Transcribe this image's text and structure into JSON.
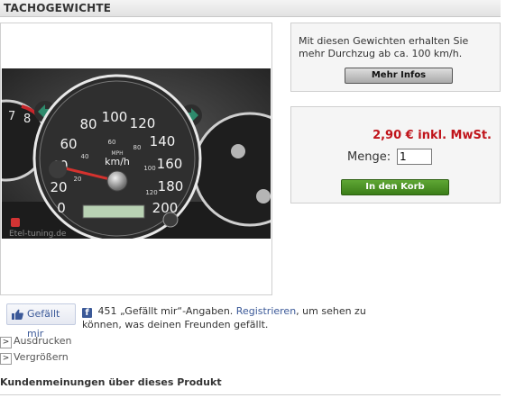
{
  "header": {
    "title": "TACHOGEWICHTE"
  },
  "product_image": {
    "alt": "Tachometer",
    "watermark": "Etel-tuning.de",
    "dial_numbers": [
      "0",
      "20",
      "40",
      "60",
      "80",
      "100",
      "120",
      "140",
      "160",
      "180",
      "200"
    ],
    "inner_numbers": [
      "20",
      "40",
      "60",
      "80",
      "100",
      "120"
    ],
    "unit": "km/h",
    "unit_small": "MPH",
    "left_numbers": [
      "7",
      "8"
    ]
  },
  "info_box": {
    "text": "Mit diesen Gewichten erhalten Sie mehr Durchzug ab ca. 100 km/h.",
    "more_button": "Mehr Infos"
  },
  "purchase": {
    "price": "2,90 € inkl. MwSt.",
    "quantity_label": "Menge:",
    "quantity_value": "1",
    "cart_button": "In den Korb"
  },
  "facebook": {
    "like_button": "Gefällt mir",
    "logo": "f",
    "count_text": "451 „Gefällt mir“-Angaben.",
    "register_link": "Registrieren",
    "suffix_text": ", um sehen zu können, was deinen Freunden gefällt."
  },
  "links": {
    "print": "Ausdrucken",
    "enlarge": "Vergrößern",
    "arrow": ">"
  },
  "reviews": {
    "title": "Kundenmeinungen über dieses Produkt"
  },
  "colors": {
    "price": "#c0141b",
    "cart_button": "#4a8f24",
    "facebook": "#3b5998"
  }
}
